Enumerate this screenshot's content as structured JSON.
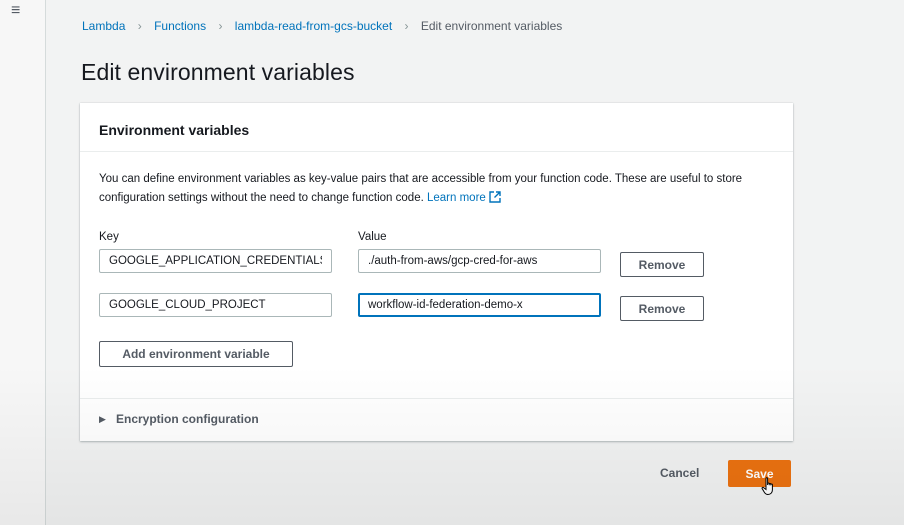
{
  "breadcrumb": {
    "items": [
      "Lambda",
      "Functions",
      "lambda-read-from-gcs-bucket"
    ],
    "current": "Edit environment variables"
  },
  "page": {
    "title": "Edit environment variables"
  },
  "env_panel": {
    "title": "Environment variables",
    "description": "You can define environment variables as key-value pairs that are accessible from your function code. These are useful to store configuration settings without the need to change function code.",
    "learn_more": "Learn more",
    "key_label": "Key",
    "value_label": "Value",
    "rows": [
      {
        "key": "GOOGLE_APPLICATION_CREDENTIALS",
        "value": "./auth-from-aws/gcp-cred-for-aws",
        "remove_label": "Remove"
      },
      {
        "key": "GOOGLE_CLOUD_PROJECT",
        "value": "workflow-id-federation-demo-x",
        "remove_label": "Remove"
      }
    ],
    "add_label": "Add environment variable",
    "encryption_label": "Encryption configuration"
  },
  "footer": {
    "cancel_label": "Cancel",
    "save_label": "Save"
  },
  "colors": {
    "accent_link": "#0073bb",
    "primary_button": "#ec7211",
    "focus_border": "#0073bb"
  },
  "icons": [
    "menu-icon",
    "chevron-right-icon",
    "external-link-icon",
    "caret-right-icon",
    "hand-pointer-icon"
  ]
}
